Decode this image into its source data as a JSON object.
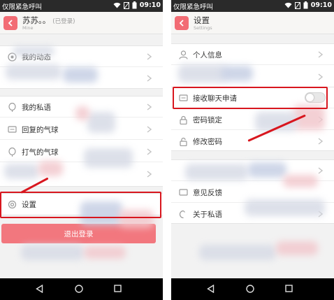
{
  "statusbar": {
    "carrier": "仅限紧急呼叫",
    "time": "09:10"
  },
  "left": {
    "header": {
      "title": "苏苏。。",
      "status": "(已登录)",
      "subtitle": "Mine"
    },
    "menu": [
      {
        "label": "我的动态",
        "icon": "dynamic-icon"
      },
      {
        "label": "我的私语",
        "icon": "balloon-icon"
      },
      {
        "label": "回复的气球",
        "icon": "comment-icon"
      },
      {
        "label": "打气的气球",
        "icon": "balloon-icon"
      },
      {
        "label": "设置",
        "icon": "gear-icon"
      }
    ],
    "logout_label": "退出登录"
  },
  "right": {
    "header": {
      "title": "设置",
      "subtitle": "Settings"
    },
    "rows": [
      {
        "label": "个人信息",
        "icon": "person-icon"
      },
      {
        "label": "接收聊天申请",
        "icon": "chat-request-icon",
        "toggle_on": false
      },
      {
        "label": "密码锁定",
        "icon": "lock-icon"
      },
      {
        "label": "修改密码",
        "icon": "key-icon"
      },
      {
        "label": "意见反馈",
        "icon": "feedback-icon"
      },
      {
        "label": "关于私语",
        "icon": "info-icon"
      }
    ]
  },
  "colors": {
    "accent": "#f26c74",
    "highlight": "#d8161e",
    "logout": "#f2777e"
  }
}
